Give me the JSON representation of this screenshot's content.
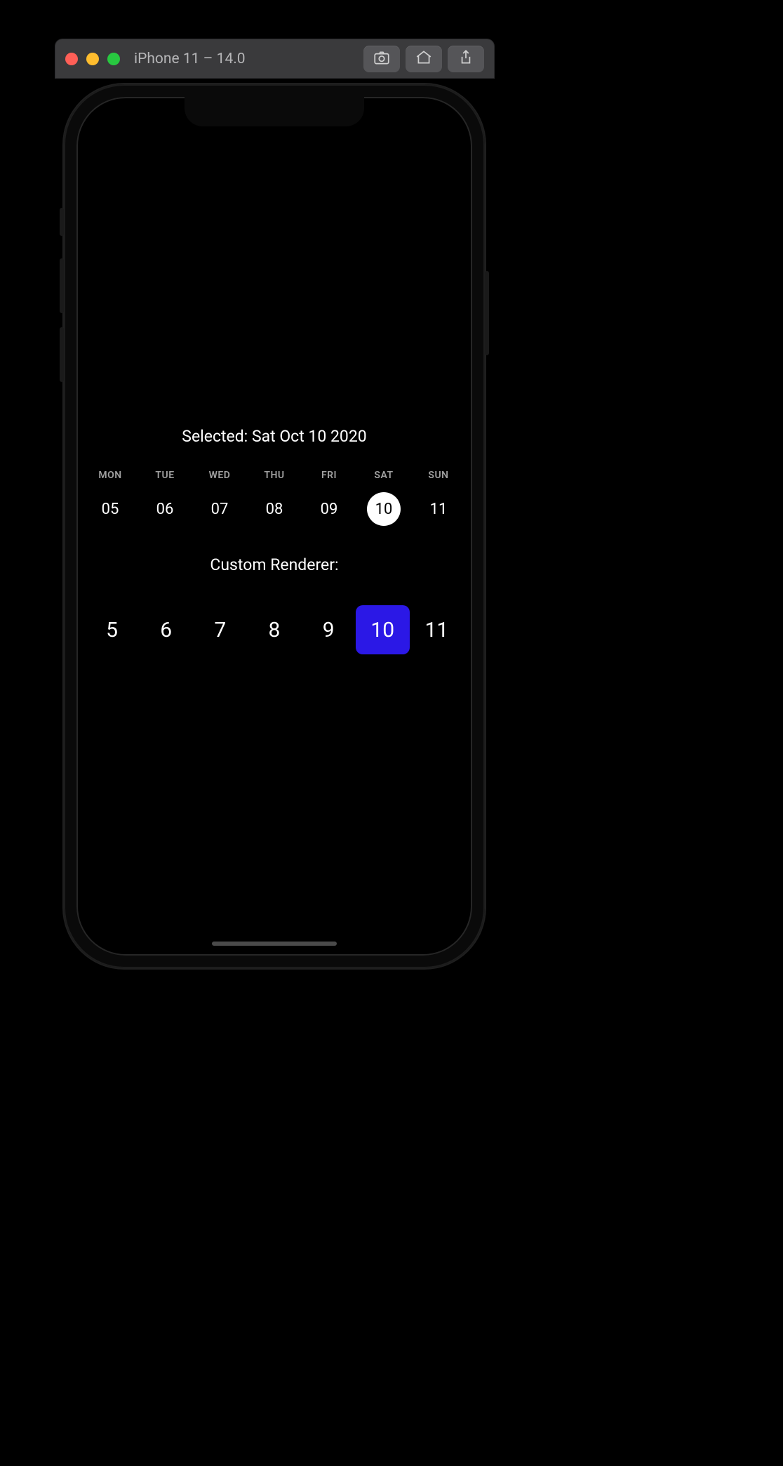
{
  "titlebar": {
    "title": "iPhone 11 – 14.0",
    "buttons": {
      "screenshot_icon": "camera-icon",
      "home_icon": "home-icon",
      "share_icon": "share-icon"
    }
  },
  "content": {
    "selected_label": "Selected: Sat Oct 10 2020",
    "days": [
      {
        "dow": "MON",
        "date": "05",
        "short": "5",
        "selected": false
      },
      {
        "dow": "TUE",
        "date": "06",
        "short": "6",
        "selected": false
      },
      {
        "dow": "WED",
        "date": "07",
        "short": "7",
        "selected": false
      },
      {
        "dow": "THU",
        "date": "08",
        "short": "8",
        "selected": false
      },
      {
        "dow": "FRI",
        "date": "09",
        "short": "9",
        "selected": false
      },
      {
        "dow": "SAT",
        "date": "10",
        "short": "10",
        "selected": true
      },
      {
        "dow": "SUN",
        "date": "11",
        "short": "11",
        "selected": false
      }
    ],
    "custom_label": "Custom Renderer:"
  },
  "colors": {
    "accent_blue": "#2b18e6",
    "selected_circle": "#ffffff"
  }
}
